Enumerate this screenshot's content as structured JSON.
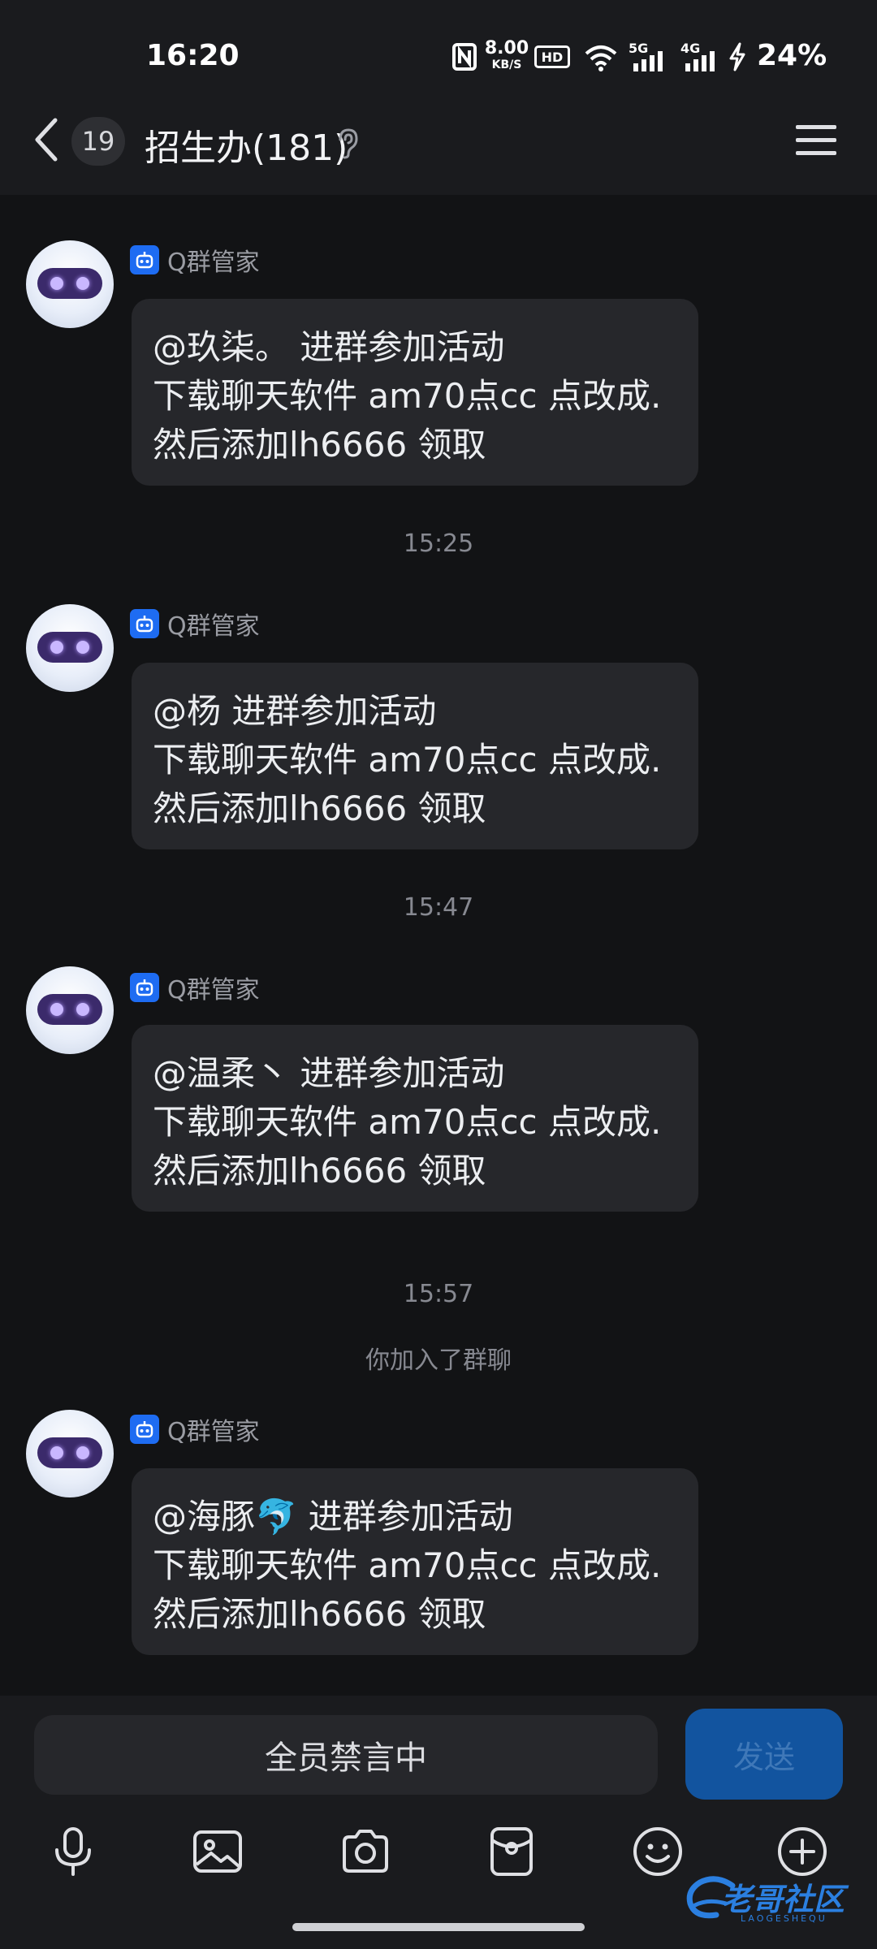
{
  "status_bar": {
    "time": "16:20",
    "net_speed_top": "8.00",
    "net_speed_unit": "KB/S",
    "hd_label": "HD",
    "sig1_label": "5G",
    "sig2_label": "4G",
    "battery": "24%"
  },
  "header": {
    "unread_count": "19",
    "title": "招生办(181)"
  },
  "messages": [
    {
      "sender": "Q群管家",
      "lines": [
        "@玖柒。 进群参加活动",
        "下载聊天软件 am70点cc 点改成.",
        "然后添加lh6666 领取"
      ]
    },
    {
      "sender": "Q群管家",
      "lines": [
        "@杨 进群参加活动",
        "下载聊天软件 am70点cc 点改成.",
        "然后添加lh6666 领取"
      ]
    },
    {
      "sender": "Q群管家",
      "lines": [
        "@温柔丶 进群参加活动",
        "下载聊天软件 am70点cc 点改成.",
        "然后添加lh6666 领取"
      ]
    },
    {
      "sender": "Q群管家",
      "lines": [
        "@海豚🐬 进群参加活动",
        "下载聊天软件 am70点cc 点改成.",
        "然后添加lh6666 领取"
      ]
    }
  ],
  "timestamps": [
    "15:25",
    "15:47",
    "15:57"
  ],
  "system_note": "你加入了群聊",
  "input": {
    "muted_label": "全员禁言中",
    "send_label": "发送"
  },
  "toolbar_icons": [
    "microphone-icon",
    "image-icon",
    "camera-icon",
    "red-packet-icon",
    "emoji-icon",
    "plus-icon"
  ],
  "watermark": {
    "main": "老哥社区",
    "sub": "LAOGESHEQU"
  },
  "colors": {
    "background": "#121315",
    "bubble": "#26272b",
    "accent_blue": "#1e6cf2",
    "send_button": "#12549f"
  }
}
